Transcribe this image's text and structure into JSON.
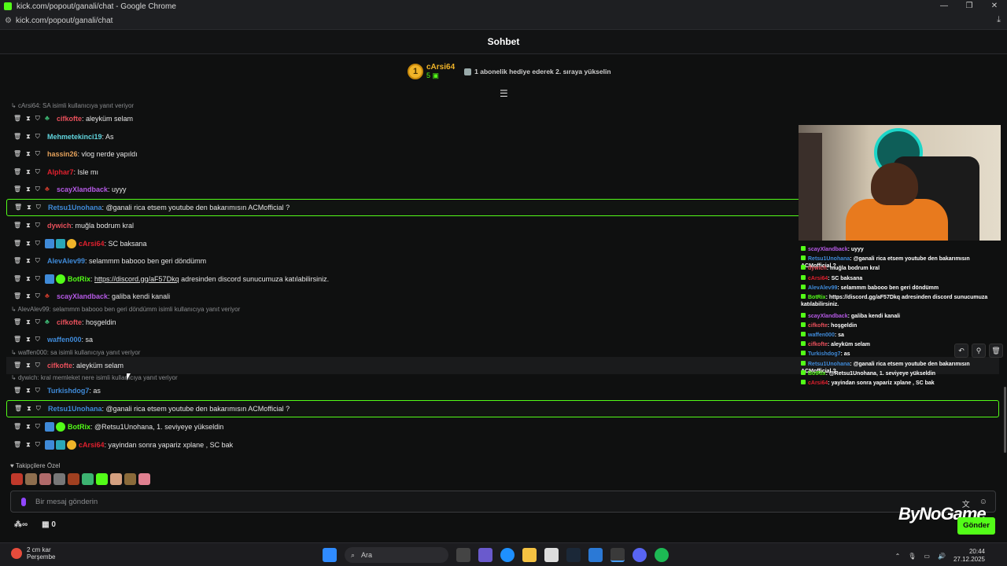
{
  "window": {
    "title": "kick.com/popout/ganali/chat - Google Chrome",
    "url": "kick.com/popout/ganali/chat"
  },
  "chat_header": {
    "title": "Sohbet"
  },
  "pinned": {
    "rank": "1",
    "user": "cArsi64",
    "count": "5",
    "info": "1 abonelik hediye ederek 2. sıraya yükselin"
  },
  "colors": {
    "accent": "#53fc18",
    "gold": "#f0b429"
  },
  "messages": [
    {
      "reply": "cArsi64: SA isimli kullanıcıya yanıt veriyor"
    },
    {
      "user": "cifkofte",
      "color": "#e8505b",
      "badges": [
        "pig"
      ],
      "text": ": aleyküm selam"
    },
    {
      "user": "Mehmetekinci19",
      "color": "#61d5de",
      "badges": [],
      "text": ": As"
    },
    {
      "user": "hassin26",
      "color": "#e3a05a",
      "badges": [],
      "text": ": vlog nerde yapıldı"
    },
    {
      "user": "Alphar7",
      "color": "#e0202e",
      "badges": [],
      "text": ": Isle mı"
    },
    {
      "user": "scayXlandback",
      "color": "#b65ae6",
      "badges": [
        "pigred"
      ],
      "text": ": uyyy"
    },
    {
      "user": "Retsu1Unohana",
      "color": "#3f8ad8",
      "badges": [],
      "text": ": @ganali rica etsem youtube den bakarımısın ACMofficial ?",
      "highlight": true
    },
    {
      "user": "dywich",
      "color": "#e8505b",
      "badges": [],
      "text": ": muğla bodrum kral"
    },
    {
      "user": "cArsi64",
      "color": "#e0202e",
      "badges": [
        "blue",
        "teal",
        "gold"
      ],
      "text": ": SC baksana"
    },
    {
      "user": "AlevAlev99",
      "color": "#3f8ad8",
      "badges": [],
      "text": ": selammm babooo ben geri döndümm"
    },
    {
      "user": "BotRix",
      "color": "#53fc18",
      "badges": [
        "blue",
        "green"
      ],
      "text": ": ",
      "link": "https://discord.gg/aF57Dkq",
      "after": " adresinden discord sunucumuza katılabilirsiniz."
    },
    {
      "user": "scayXlandback",
      "color": "#b65ae6",
      "badges": [
        "pigred"
      ],
      "text": ": galiba kendi kanali"
    },
    {
      "reply": "AlevAlev99: selammm babooo ben geri döndümm isimli kullanıcıya yanıt veriyor"
    },
    {
      "user": "cifkofte",
      "color": "#e8505b",
      "badges": [
        "pig"
      ],
      "text": ": hoşgeldin"
    },
    {
      "user": "waffen000",
      "color": "#3f8ad8",
      "badges": [],
      "text": ": sa"
    },
    {
      "reply": "waffen000: sa isimli kullanıcıya yanıt veriyor"
    },
    {
      "user": "cifkofte",
      "color": "#e8505b",
      "badges": [],
      "text": ": aleyküm selam",
      "hover": true
    },
    {
      "reply": "dywich: kral memleket nere isimli kullanıcıya yanıt veriyor"
    },
    {
      "user": "Turkishdog7",
      "color": "#3f8ad8",
      "badges": [],
      "text": ": as"
    },
    {
      "user": "Retsu1Unohana",
      "color": "#3f8ad8",
      "badges": [],
      "text": ": @ganali rica etsem youtube den bakarımısın ACMofficial ?",
      "highlight": true
    },
    {
      "user": "BotRix",
      "color": "#53fc18",
      "badges": [
        "blue",
        "green"
      ],
      "text": ": @Retsu1Unohana, 1. seviyeye yükseldin"
    },
    {
      "user": "cArsi64",
      "color": "#e0202e",
      "badges": [
        "blue",
        "teal",
        "gold"
      ],
      "text": ": yayindan sonra yapariz xplane , SC bak"
    }
  ],
  "followers_only": "Takipçilere Özel",
  "emote_colors": [
    "#c0392b",
    "#8e6e4e",
    "#b06a6a",
    "#777",
    "#a04020",
    "#3cb371",
    "#53fc18",
    "#d4a080",
    "#8a6a3a",
    "#e08090"
  ],
  "input": {
    "placeholder": "Bir mesaj gönderin"
  },
  "bottom": {
    "count": "0"
  },
  "send_label": "Gönder",
  "brand": "ByNoGame",
  "overlay_lines": [
    {
      "u": "scayXlandback",
      "c": "#b65ae6",
      "t": ": uyyy"
    },
    {
      "u": "Retsu1Unohana",
      "c": "#3f8ad8",
      "t": ": @ganali rica etsem youtube den bakarımısın ACMofficial ?"
    },
    {
      "u": "dywich",
      "c": "#e8505b",
      "t": ": muğla bodrum kral"
    },
    {
      "u": "cArsi64",
      "c": "#e0202e",
      "t": ": SC baksana"
    },
    {
      "u": "AlevAlev99",
      "c": "#3f8ad8",
      "t": ": selammm babooo ben geri döndümm"
    },
    {
      "u": "BotRix",
      "c": "#53fc18",
      "t": ": https://discord.gg/aF57Dkq adresinden discord sunucumuza katılabilirsiniz."
    },
    {
      "u": "scayXlandback",
      "c": "#b65ae6",
      "t": ": galiba kendi kanali"
    },
    {
      "u": "cifkofte",
      "c": "#e8505b",
      "t": ": hoşgeldin"
    },
    {
      "u": "waffen000",
      "c": "#3f8ad8",
      "t": ": sa"
    },
    {
      "u": "cifkofte",
      "c": "#e8505b",
      "t": ": aleyküm selam"
    },
    {
      "u": "Turkishdog7",
      "c": "#3f8ad8",
      "t": ": as"
    },
    {
      "u": "Retsu1Unohana",
      "c": "#3f8ad8",
      "t": ": @ganali rica etsem youtube den bakarımısın ACMofficial ?"
    },
    {
      "u": "BotRix",
      "c": "#53fc18",
      "t": ": @Retsu1Unohana, 1. seviyeye yükseldin"
    },
    {
      "u": "cArsi64",
      "c": "#e0202e",
      "t": ": yayindan sonra yapariz xplane , SC bak"
    }
  ],
  "taskbar": {
    "weather_temp": "2 cm kar",
    "weather_day": "Perşembe",
    "search": "Ara",
    "time": "20:44",
    "date": "27.12.2025"
  }
}
